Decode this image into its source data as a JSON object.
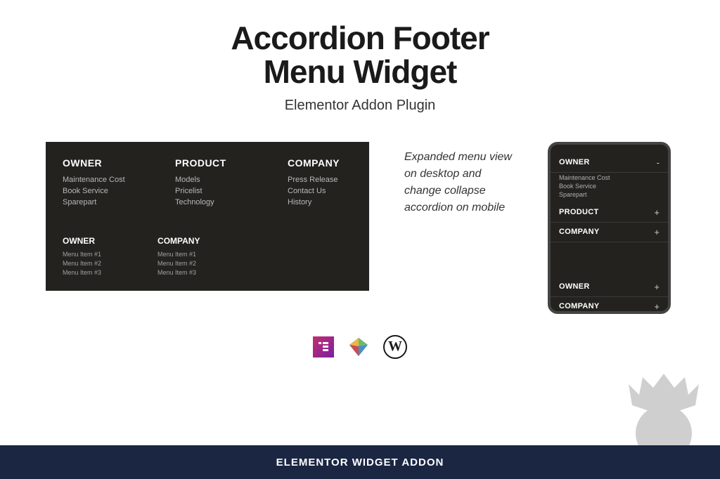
{
  "header": {
    "title_line1": "Accordion Footer",
    "title_line2": "Menu Widget",
    "subtitle": "Elementor Addon Plugin"
  },
  "desktop": {
    "row1": [
      {
        "title": "OWNER",
        "items": [
          "Maintenance Cost",
          "Book Service",
          "Sparepart"
        ]
      },
      {
        "title": "PRODUCT",
        "items": [
          "Models",
          "Pricelist",
          "Technology"
        ]
      },
      {
        "title": "COMPANY",
        "items": [
          "Press Release",
          "Contact Us",
          "History"
        ]
      }
    ],
    "row2": [
      {
        "title": "OWNER",
        "items": [
          "Menu Item #1",
          "Menu Item #2",
          "Menu Item #3"
        ]
      },
      {
        "title": "COMPANY",
        "items": [
          "Menu Item #1",
          "Menu Item #2",
          "Menu Item #3"
        ]
      }
    ]
  },
  "description": "Expanded menu view on desktop and change collapse accordion on mobile",
  "mobile": {
    "sections": [
      {
        "title": "OWNER",
        "toggle": "-",
        "items": [
          "Maintenance Cost",
          "Book Service",
          "Sparepart"
        ],
        "open": true
      },
      {
        "title": "PRODUCT",
        "toggle": "+",
        "open": false
      },
      {
        "title": "COMPANY",
        "toggle": "+",
        "open": false
      }
    ],
    "sections2": [
      {
        "title": "OWNER",
        "toggle": "+"
      },
      {
        "title": "COMPANY",
        "toggle": "+"
      }
    ]
  },
  "icons": {
    "elementor": "elementor-icon",
    "gem": "gem-icon",
    "wordpress": "wordpress-icon",
    "wp_letter": "W"
  },
  "footer_bar": "ELEMENTOR WIDGET ADDON"
}
